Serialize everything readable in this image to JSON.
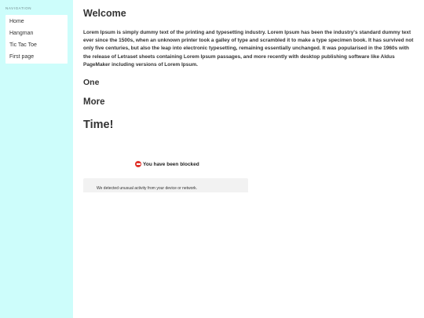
{
  "sidebar": {
    "heading": "NAVIGATION",
    "items": [
      {
        "label": "Home"
      },
      {
        "label": "Hangman"
      },
      {
        "label": "Tic Tac Toe"
      },
      {
        "label": "First page"
      }
    ]
  },
  "main": {
    "title": "Welcome",
    "intro": "Lorem Ipsum is simply dummy text of the printing and typesetting industry. Lorem Ipsum has been the industry's standard dummy text ever since the 1500s, when an unknown printer took a galley of type and scrambled it to make a type specimen book. It has survived not only five centuries, but also the leap into electronic typesetting, remaining essentially unchanged. It was popularised in the 1960s with the release of Letraset sheets containing Lorem Ipsum passages, and more recently with desktop publishing software like Aldus PageMaker including versions of Lorem Ipsum.",
    "headings": {
      "one": "One",
      "more": "More",
      "time": "Time!"
    }
  },
  "blocked": {
    "icon": "no-entry-icon",
    "title": "You have been blocked",
    "message": "We detected unusual activity from your device or network.",
    "colors": {
      "icon": "#e0332c",
      "box": "#f2f2f2"
    }
  },
  "colors": {
    "sidebar_bg": "#cdfdfb",
    "text": "#333333"
  }
}
